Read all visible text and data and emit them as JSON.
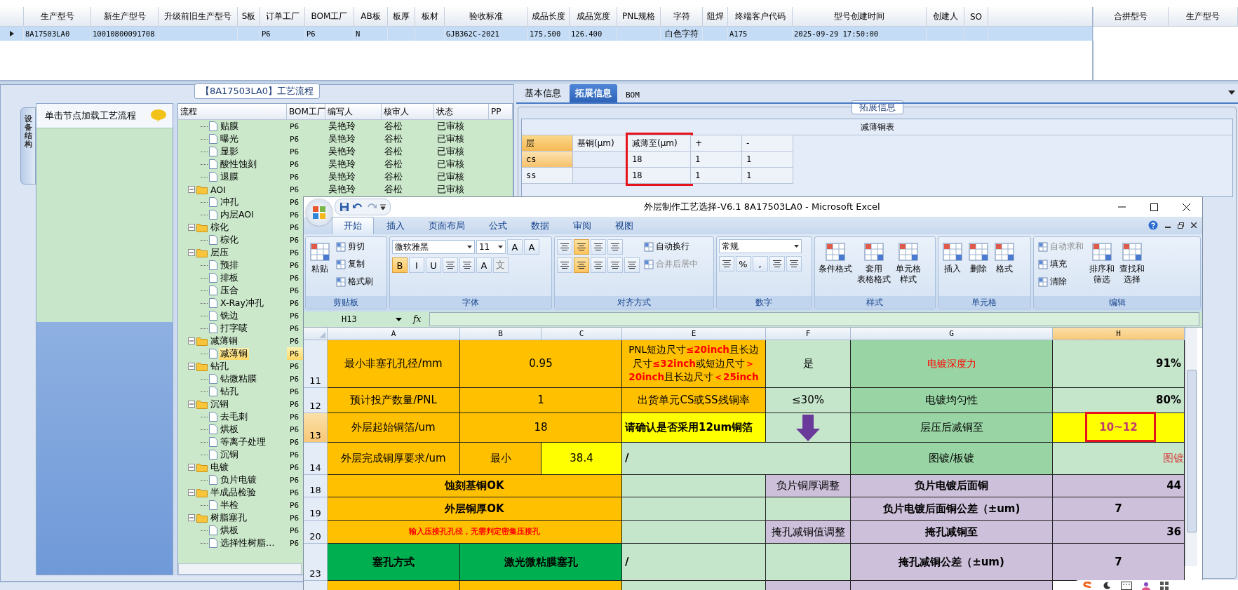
{
  "top_grid": {
    "columns": [
      "生产型号",
      "新生产型号",
      "升级前旧生产型号",
      "S板",
      "订单工厂",
      "BOM工厂",
      "AB板",
      "板厚",
      "板材",
      "验收标准",
      "成品长度",
      "成品宽度",
      "PNL规格",
      "字符",
      "阻焊",
      "终端客户代码",
      "型号创建时间",
      "创建人",
      "SO"
    ],
    "rows": [
      {
        "selected": true,
        "cells": [
          "8A17503LA0",
          "10010800091708",
          "",
          "",
          "P6",
          "P6",
          "N",
          "",
          "",
          "GJB362C-2021",
          "175.500",
          "126.400",
          "",
          "白色字符",
          "",
          "A175",
          "2025-09-29 17:50:00",
          "",
          ""
        ]
      }
    ]
  },
  "right_grid": {
    "columns": [
      "合拼型号",
      "生产型号"
    ]
  },
  "process": {
    "title": "【8A17503LA0】工艺流程",
    "side_tab": "设备结构",
    "panel_title": "单击节点加载工艺流程",
    "columns": [
      "流程",
      "BOM工厂",
      "编写人",
      "核审人",
      "状态",
      "PP"
    ],
    "nodes": [
      {
        "children": [
          {
            "label": "贴膜",
            "bom": "P6",
            "writer": "吴艳玲",
            "reviewer": "谷松",
            "status": "已审核",
            "selected": false
          },
          {
            "label": "曝光",
            "bom": "P6",
            "writer": "吴艳玲",
            "reviewer": "谷松",
            "status": "已审核",
            "selected": false
          },
          {
            "label": "显影",
            "bom": "P6",
            "writer": "吴艳玲",
            "reviewer": "谷松",
            "status": "已审核",
            "selected": false
          },
          {
            "label": "酸性蚀刻",
            "bom": "P6",
            "writer": "吴艳玲",
            "reviewer": "谷松",
            "status": "已审核",
            "selected": false
          },
          {
            "label": "退膜",
            "bom": "P6",
            "writer": "吴艳玲",
            "reviewer": "谷松",
            "status": "已审核",
            "selected": false
          }
        ]
      },
      {
        "label": "AOI",
        "bom": "P6",
        "writer": "吴艳玲",
        "reviewer": "谷松",
        "status": "已审核",
        "selected": false,
        "expanded": true,
        "children": [
          {
            "label": "冲孔",
            "bom": "P6",
            "selected": false
          },
          {
            "label": "内层AOI",
            "bom": "P6",
            "selected": false
          }
        ]
      },
      {
        "label": "棕化",
        "bom": "P6",
        "selected": false,
        "expanded": true,
        "children": [
          {
            "label": "棕化",
            "bom": "P6",
            "selected": false
          }
        ]
      },
      {
        "label": "层压",
        "bom": "P6",
        "selected": false,
        "expanded": true,
        "children": [
          {
            "label": "预排",
            "bom": "P6",
            "selected": false
          },
          {
            "label": "排板",
            "bom": "P6",
            "selected": false
          },
          {
            "label": "压合",
            "bom": "P6",
            "selected": false
          },
          {
            "label": "X-Ray冲孔",
            "bom": "P6",
            "selected": false
          },
          {
            "label": "铣边",
            "bom": "P6",
            "selected": false
          },
          {
            "label": "打字唛",
            "bom": "P6",
            "selected": false
          }
        ]
      },
      {
        "label": "减薄铜",
        "bom": "P6",
        "selected": false,
        "expanded": true,
        "children": [
          {
            "label": "减薄铜",
            "bom": "P6",
            "selected": true
          }
        ]
      },
      {
        "label": "钻孔",
        "bom": "P6",
        "selected": false,
        "expanded": true,
        "children": [
          {
            "label": "钻微粘膜",
            "bom": "P6",
            "selected": false
          },
          {
            "label": "钻孔",
            "bom": "P6",
            "selected": false
          }
        ]
      },
      {
        "label": "沉铜",
        "bom": "P6",
        "selected": false,
        "expanded": true,
        "children": [
          {
            "label": "去毛刺",
            "bom": "P6",
            "selected": false
          },
          {
            "label": "烘板",
            "bom": "P6",
            "selected": false
          },
          {
            "label": "等离子处理",
            "bom": "P6",
            "selected": false
          },
          {
            "label": "沉铜",
            "bom": "P6",
            "selected": false
          }
        ]
      },
      {
        "label": "电镀",
        "bom": "P6",
        "selected": false,
        "expanded": true,
        "children": [
          {
            "label": "负片电镀",
            "bom": "P6",
            "selected": false
          }
        ]
      },
      {
        "label": "半成品检验",
        "bom": "P6",
        "selected": false,
        "expanded": true,
        "children": [
          {
            "label": "半检",
            "bom": "P6",
            "selected": false
          }
        ]
      },
      {
        "label": "树脂塞孔",
        "bom": "P6",
        "selected": false,
        "expanded": true,
        "children": [
          {
            "label": "烘板",
            "bom": "P6",
            "selected": false
          },
          {
            "label": "选择性树脂…",
            "bom": "P6",
            "selected": false
          }
        ]
      }
    ]
  },
  "detail": {
    "tabs": [
      {
        "label": "基本信息",
        "selected": false
      },
      {
        "label": "拓展信息",
        "selected": true
      },
      {
        "label": "BOM",
        "selected": false
      }
    ],
    "group_title": "拓展信息",
    "table_title": "减薄铜表",
    "layer_header": "层",
    "rows": [
      {
        "label": "cs",
        "selected": true
      },
      {
        "label": "ss",
        "selected": false
      }
    ],
    "columns": [
      {
        "label": "基铜(μm)",
        "boxed": false
      },
      {
        "label": "减薄至(μm)",
        "boxed": true,
        "values": [
          "18",
          "18"
        ]
      },
      {
        "label": "+",
        "boxed": false,
        "values": [
          "1",
          "1"
        ]
      },
      {
        "label": "-",
        "boxed": false,
        "values": [
          "1",
          "1"
        ]
      }
    ]
  },
  "excel": {
    "title": "外层制作工艺选择-V6.1 8A17503LA0 - Microsoft Excel",
    "tabs": [
      {
        "label": "开始",
        "selected": true
      },
      {
        "label": "插入",
        "selected": false
      },
      {
        "label": "页面布局",
        "selected": false
      },
      {
        "label": "公式",
        "selected": false
      },
      {
        "label": "数据",
        "selected": false
      },
      {
        "label": "审阅",
        "selected": false
      },
      {
        "label": "视图",
        "selected": false
      }
    ],
    "groups": [
      {
        "title": "剪贴板",
        "columns": [
          [
            {
              "kind": "large",
              "lines": [
                "粘贴"
              ],
              "disabled": false
            }
          ],
          [
            {
              "kind": "small",
              "label": "剪切",
              "disabled": false
            },
            {
              "kind": "small",
              "label": "复制",
              "disabled": false
            },
            {
              "kind": "small",
              "label": "格式刷",
              "disabled": false
            }
          ]
        ]
      },
      {
        "title": "字体",
        "columns": [
          [
            {
              "kind": "bar",
              "items": [
                {
                  "kind": "combo",
                  "value": "微软雅黑"
                },
                {
                  "kind": "combo",
                  "value": "11"
                },
                {
                  "kind": "tool",
                  "label": "A",
                  "selected": false,
                  "disabled": false
                },
                {
                  "kind": "tool",
                  "label": "A",
                  "selected": false,
                  "disabled": false
                }
              ]
            },
            {
              "kind": "bar",
              "items": [
                {
                  "kind": "tool",
                  "label": "B",
                  "selected": true,
                  "disabled": false
                },
                {
                  "kind": "tool",
                  "label": "I",
                  "selected": false,
                  "disabled": false
                },
                {
                  "kind": "tool",
                  "label": "U",
                  "selected": false,
                  "disabled": false
                },
                {
                  "kind": "tool",
                  "selected": false,
                  "disabled": false
                },
                {
                  "kind": "tool",
                  "selected": false,
                  "disabled": false
                },
                {
                  "kind": "tool",
                  "label": "A",
                  "selected": false,
                  "disabled": false
                },
                {
                  "kind": "tool",
                  "label": "文",
                  "selected": false,
                  "disabled": true
                }
              ]
            }
          ]
        ]
      },
      {
        "title": "对齐方式",
        "columns": [
          [
            {
              "kind": "bar",
              "items": [
                {
                  "kind": "tool",
                  "selected": false,
                  "disabled": false
                },
                {
                  "kind": "tool",
                  "selected": true,
                  "disabled": false
                },
                {
                  "kind": "tool",
                  "selected": false,
                  "disabled": false
                },
                {
                  "kind": "tool",
                  "selected": false,
                  "disabled": false
                }
              ]
            },
            {
              "kind": "bar",
              "items": [
                {
                  "kind": "tool",
                  "selected": false,
                  "disabled": false
                },
                {
                  "kind": "tool",
                  "selected": true,
                  "disabled": false
                },
                {
                  "kind": "tool",
                  "selected": false,
                  "disabled": false
                },
                {
                  "kind": "tool",
                  "selected": false,
                  "disabled": false
                },
                {
                  "kind": "tool",
                  "selected": false,
                  "disabled": false
                }
              ]
            }
          ],
          [
            {
              "kind": "small",
              "label": "自动换行",
              "disabled": false
            },
            {
              "kind": "small",
              "label": "合并后居中",
              "disabled": true
            }
          ]
        ]
      },
      {
        "title": "数字",
        "columns": [
          [
            {
              "kind": "bar",
              "items": [
                {
                  "kind": "combo",
                  "value": "常规"
                }
              ]
            },
            {
              "kind": "bar",
              "items": [
                {
                  "kind": "tool",
                  "selected": false,
                  "disabled": false
                },
                {
                  "kind": "tool",
                  "label": "%",
                  "selected": false,
                  "disabled": false
                },
                {
                  "kind": "tool",
                  "label": ",",
                  "selected": false,
                  "disabled": false
                },
                {
                  "kind": "tool",
                  "selected": false,
                  "disabled": false
                },
                {
                  "kind": "tool",
                  "selected": false,
                  "disabled": false
                }
              ]
            }
          ]
        ]
      },
      {
        "title": "样式",
        "columns": [
          [
            {
              "kind": "large",
              "lines": [
                "条件格式"
              ],
              "disabled": false
            }
          ],
          [
            {
              "kind": "large",
              "lines": [
                "套用",
                "表格格式"
              ],
              "disabled": false
            }
          ],
          [
            {
              "kind": "large",
              "lines": [
                "单元格",
                "样式"
              ],
              "disabled": false
            }
          ]
        ]
      },
      {
        "title": "单元格",
        "columns": [
          [
            {
              "kind": "large",
              "lines": [
                "插入"
              ],
              "disabled": false
            }
          ],
          [
            {
              "kind": "large",
              "lines": [
                "删除"
              ],
              "disabled": false
            }
          ],
          [
            {
              "kind": "large",
              "lines": [
                "格式"
              ],
              "disabled": false
            }
          ]
        ]
      },
      {
        "title": "编辑",
        "columns": [
          [
            {
              "kind": "small",
              "label": "自动求和",
              "disabled": true
            },
            {
              "kind": "small",
              "label": "填充",
              "disabled": false
            },
            {
              "kind": "small",
              "label": "清除",
              "disabled": false
            }
          ],
          [
            {
              "kind": "large",
              "lines": [
                "排序和",
                "筛选"
              ],
              "disabled": false
            }
          ],
          [
            {
              "kind": "large",
              "lines": [
                "查找和",
                "选择"
              ],
              "disabled": false
            }
          ]
        ]
      }
    ],
    "name_box": "H13",
    "fx": "fx",
    "columns": [
      {
        "label": "A",
        "selected": false
      },
      {
        "label": "B",
        "selected": false
      },
      {
        "label": "C",
        "selected": false
      },
      {
        "label": "E",
        "selected": false
      },
      {
        "label": "F",
        "selected": false
      },
      {
        "label": "G",
        "selected": false
      },
      {
        "label": "H",
        "selected": true
      }
    ],
    "rows": [
      {
        "header": "11",
        "selected": false,
        "cells": [
          {
            "kind": "label",
            "text": "最小非塞孔孔径/mm",
            "color": "#ffc000"
          },
          {
            "kind": "label",
            "text": "0.95",
            "color": "#ffc000"
          },
          "",
          {
            "kind": "runs",
            "color": "#ffc000",
            "runs": [
              {
                "text": "PNL短边尺寸",
                "warn": false
              },
              {
                "text": "≤20inch",
                "warn": true
              },
              {
                "text": "且长边尺寸",
                "warn": false
              },
              {
                "text": "≤32inch",
                "warn": true
              },
              {
                "text": "或短边尺寸",
                "warn": false
              },
              {
                "text": "＞20inch",
                "warn": true
              },
              {
                "text": "且长边尺寸",
                "warn": false
              },
              {
                "text": "＜25inch",
                "warn": true
              }
            ]
          },
          {
            "kind": "label",
            "text": "是",
            "color": "#c6e6cc"
          },
          {
            "kind": "alert",
            "text": "电镀深度力",
            "color": "#99d5a4"
          },
          {
            "kind": "percent",
            "text": "91%",
            "color": "#c6e6cc"
          }
        ]
      },
      {
        "header": "12",
        "selected": false,
        "cells": [
          {
            "kind": "label",
            "text": "预计投产数量/PNL",
            "color": "#ffc000"
          },
          {
            "kind": "label",
            "text": "1",
            "color": "#ffc000"
          },
          "",
          {
            "kind": "label",
            "text": "出货单元CS或SS残铜率",
            "color": "#ffc000"
          },
          {
            "kind": "label",
            "text": "≤30%",
            "color": "#c6e6cc"
          },
          {
            "kind": "label",
            "text": "电镀均匀性",
            "color": "#99d5a4"
          },
          {
            "kind": "percent",
            "text": "80%",
            "color": "#c6e6cc"
          }
        ]
      },
      {
        "header": "13",
        "selected": true,
        "cells": [
          {
            "kind": "label",
            "text": "外层起始铜箔/um",
            "color": "#ffc000"
          },
          {
            "kind": "label",
            "text": "18",
            "color": "#ffc000"
          },
          "",
          {
            "kind": "mark",
            "text": "请确认是否采用12um铜箔",
            "color": "#ffff00"
          },
          {
            "kind": "arrow",
            "color": "#c6e6cc"
          },
          {
            "kind": "label",
            "text": "层压后减铜至",
            "color": "#99d5a4"
          },
          {
            "kind": "result",
            "text": "10~12",
            "color": "#ffff00",
            "boxed": true
          }
        ]
      },
      {
        "header": "14",
        "selected": false,
        "cells": [
          {
            "kind": "label",
            "text": "外层完成铜厚要求/um",
            "color": "#ffc000"
          },
          {
            "kind": "label",
            "text": "最小",
            "color": "#ffc000"
          },
          {
            "kind": "label",
            "text": "38.4",
            "color": "#ffff00"
          },
          {
            "kind": "mark",
            "text": "/",
            "color": "#c6e6cc"
          },
          "",
          {
            "kind": "label",
            "text": "图镀/板镀",
            "color": "#99d5a4"
          },
          {
            "kind": "flag",
            "text": "图镀",
            "color": "#c6e6cc"
          }
        ]
      },
      {
        "header": "18",
        "selected": false,
        "cells": [
          {
            "kind": "heading",
            "text": "蚀刻基铜OK",
            "color": "#ffc000"
          },
          "",
          "",
          {
            "kind": "blank",
            "color": "#c6e6cc"
          },
          {
            "kind": "label",
            "text": "负片铜厚调整",
            "color": "#ccc0da"
          },
          {
            "kind": "heading",
            "text": "负片电镀后面铜",
            "color": "#ccc0da"
          },
          {
            "kind": "percent",
            "text": "44",
            "color": "#ccc0da"
          }
        ]
      },
      {
        "header": "19",
        "selected": false,
        "cells": [
          {
            "kind": "heading",
            "text": "外层铜厚OK",
            "color": "#ffc000"
          },
          "",
          "",
          {
            "kind": "blank",
            "color": "#c6e6cc"
          },
          {
            "kind": "blank",
            "color": "#c6e6cc"
          },
          {
            "kind": "heading",
            "text": "负片电镀后面铜公差（±um)",
            "color": "#ccc0da"
          },
          {
            "kind": "heading",
            "text": "7",
            "color": "#ccc0da"
          }
        ]
      },
      {
        "header": "20",
        "selected": false,
        "cells": [
          {
            "kind": "note",
            "text": "输入压接孔孔径，无需判定密集压接孔",
            "color": "#ffc000"
          },
          "",
          "",
          {
            "kind": "blank",
            "color": "#c6e6cc"
          },
          {
            "kind": "label",
            "text": "掩孔减铜值调整",
            "color": "#ccc0da"
          },
          {
            "kind": "heading",
            "text": "掩孔减铜至",
            "color": "#ccc0da"
          },
          {
            "kind": "percent",
            "text": "36",
            "color": "#ccc0da"
          }
        ]
      },
      {
        "header": "23",
        "selected": false,
        "cells": [
          {
            "kind": "heading",
            "text": "塞孔方式",
            "color": "#00b050"
          },
          {
            "kind": "heading",
            "text": "激光微粘膜塞孔",
            "color": "#00b050"
          },
          "",
          {
            "kind": "mark",
            "text": "/",
            "color": "#c6e6cc"
          },
          {
            "kind": "blank",
            "color": "#c6e6cc"
          },
          {
            "kind": "heading",
            "text": "掩孔减铜公差（±um)",
            "color": "#ccc0da"
          },
          {
            "kind": "heading",
            "text": "7",
            "color": "#ccc0da"
          }
        ]
      },
      {
        "selected": false,
        "cells": [
          {
            "kind": "blank",
            "color": "#ffc000"
          },
          {
            "kind": "blank",
            "color": "#ffc000"
          },
          "",
          {
            "kind": "blank",
            "color": "#c6e6cc"
          },
          {
            "kind": "blank",
            "color": "#ccc0da"
          },
          {
            "kind": "blank",
            "color": "#ccc0da"
          }
        ]
      }
    ]
  }
}
